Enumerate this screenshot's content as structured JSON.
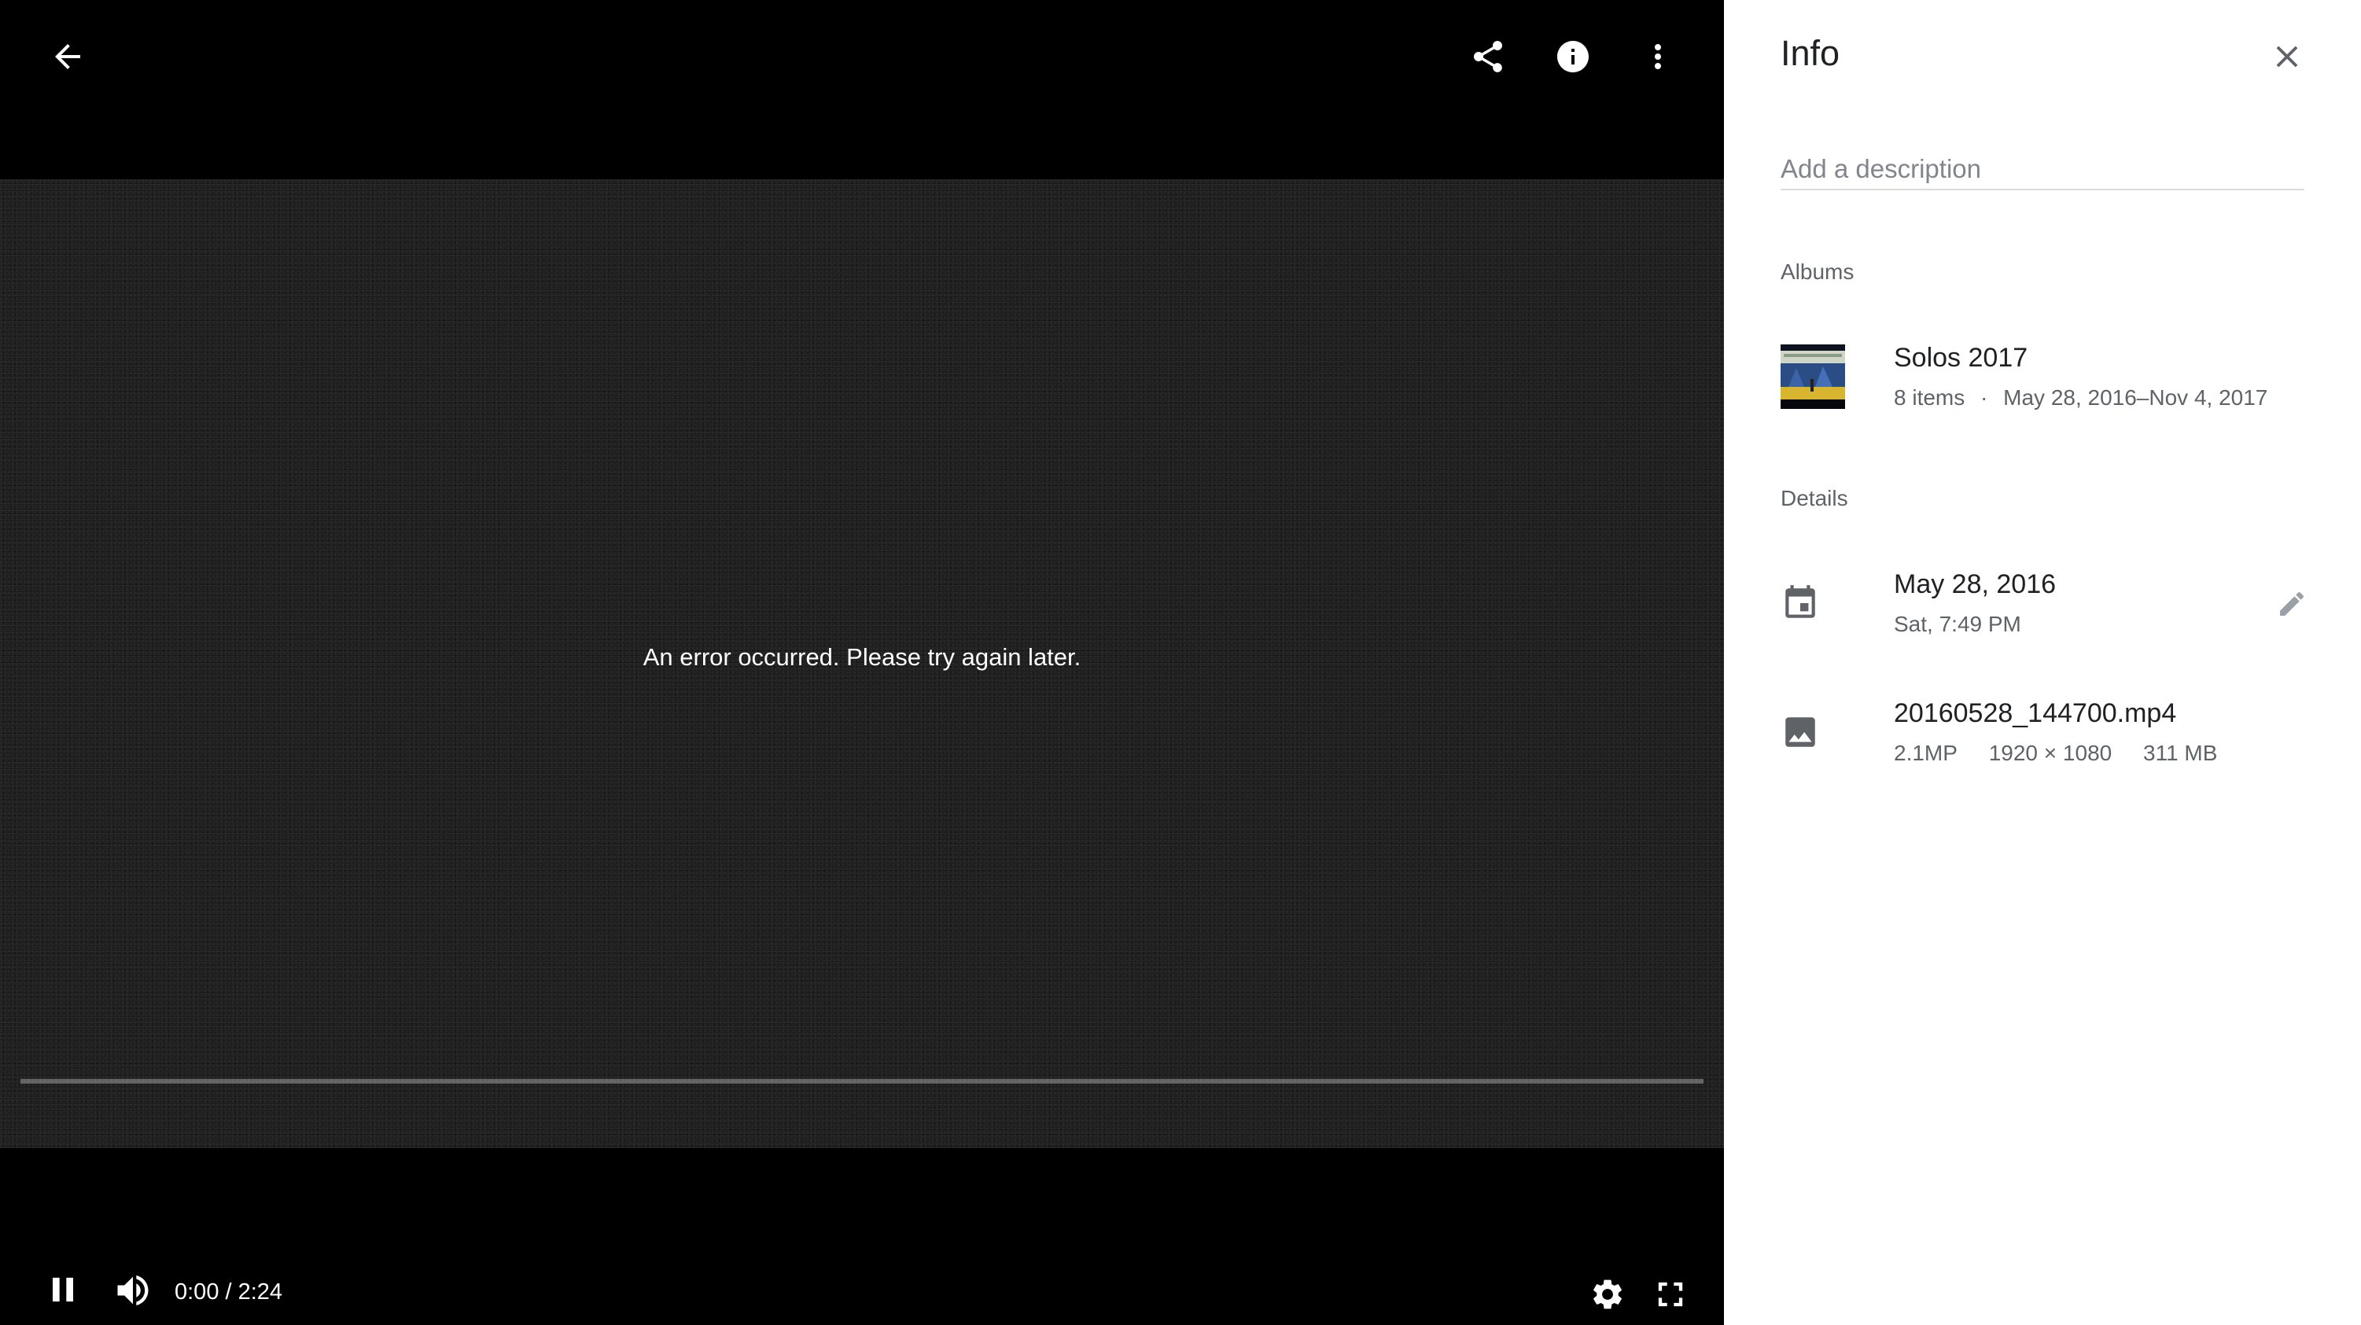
{
  "viewer": {
    "back_icon": "arrow-back-icon",
    "share_icon": "share-icon",
    "info_icon": "info-icon",
    "more_icon": "more-vert-icon",
    "error_message": "An error occurred. Please try again later.",
    "controls": {
      "play_state_icon": "pause-icon",
      "volume_icon": "volume-up-icon",
      "time_display": "0:00 / 2:24",
      "current_time": "0:00",
      "duration": "2:24",
      "progress_fraction": 0,
      "settings_icon": "settings-gear-icon",
      "fullscreen_icon": "fullscreen-icon"
    }
  },
  "info_panel": {
    "title": "Info",
    "close_icon": "close-icon",
    "description_placeholder": "Add a description",
    "albums_label": "Albums",
    "album": {
      "name": "Solos 2017",
      "item_count": "8 items",
      "separator": "·",
      "date_range": "May 28, 2016–Nov 4, 2017"
    },
    "details_label": "Details",
    "date": {
      "icon": "calendar-event-icon",
      "date": "May 28, 2016",
      "day_time": "Sat, 7:49 PM",
      "edit_icon": "edit-pencil-icon"
    },
    "file": {
      "icon": "image-icon",
      "filename": "20160528_144700.mp4",
      "megapixels": "2.1MP",
      "resolution": "1920 × 1080",
      "size": "311 MB"
    }
  },
  "colors": {
    "viewer_background": "#000000",
    "video_background": "#1c1c1c",
    "panel_background": "#ffffff",
    "primary_text": "#202124",
    "secondary_text": "#5f6368"
  }
}
